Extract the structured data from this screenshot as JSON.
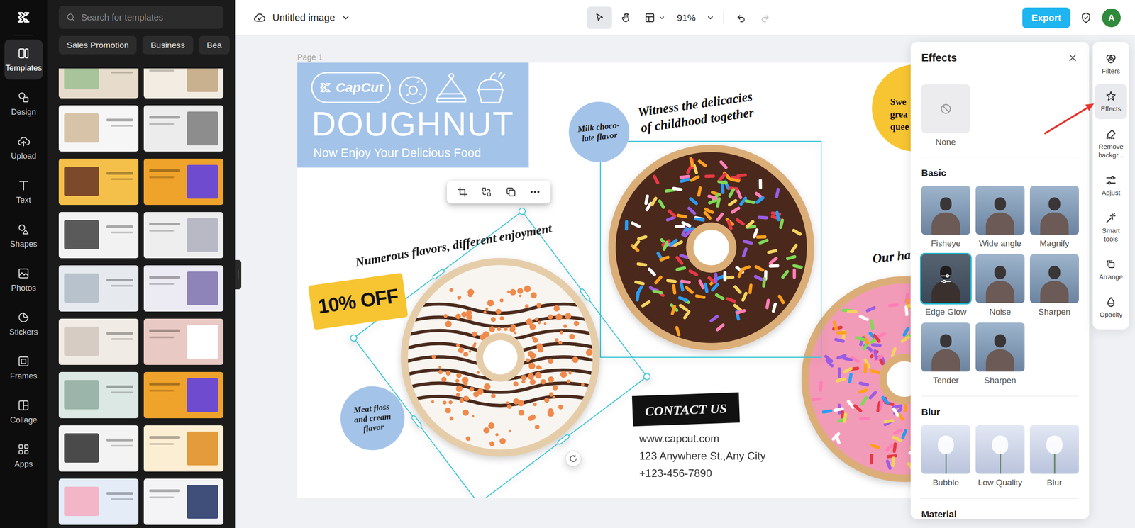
{
  "rail": {
    "items": [
      {
        "label": "Templates",
        "selected": true
      },
      {
        "label": "Design",
        "selected": false
      },
      {
        "label": "Upload",
        "selected": false
      },
      {
        "label": "Text",
        "selected": false
      },
      {
        "label": "Shapes",
        "selected": false
      },
      {
        "label": "Photos",
        "selected": false
      },
      {
        "label": "Stickers",
        "selected": false
      },
      {
        "label": "Frames",
        "selected": false
      },
      {
        "label": "Collage",
        "selected": false
      },
      {
        "label": "Apps",
        "selected": false
      }
    ]
  },
  "templates": {
    "search": {
      "placeholder": "Search for templates"
    },
    "chips": [
      "Sales Promotion",
      "Business",
      "Bea"
    ]
  },
  "toolbar": {
    "title": "Untitled image",
    "zoom": "91%",
    "select_tool": {
      "selected": true
    },
    "hand_tool": {
      "selected": false
    },
    "undo": {
      "disabled": false
    },
    "redo": {
      "disabled": true
    },
    "export": "Export",
    "avatar": "A"
  },
  "canvas": {
    "page_label": "Page 1",
    "banner": {
      "brand": "CapCut",
      "title": "DOUGHNUT",
      "subtitle": "Now Enjoy Your Delicious Food"
    },
    "badge_top": [
      "Milk choco-",
      "late flavor"
    ],
    "badge_bottom": [
      "Meat floss",
      "and cream",
      "flavor"
    ],
    "headline_top": [
      "Witness the delicacies",
      "of childhood together"
    ],
    "headline_left": "Numerous flavors, different enjoyment",
    "headline_right": "Our ha",
    "discount": "10% OFF",
    "yellow_note": [
      "Swe",
      "grea",
      "quee"
    ],
    "contact": {
      "title": "CONTACT US",
      "lines": [
        "www.capcut.com",
        "123 Anywhere St.,Any City",
        "+123-456-7890"
      ]
    },
    "doughnuts": [
      {
        "selection": "selected"
      },
      {
        "selection": "hover"
      },
      {
        "selection": "none"
      }
    ]
  },
  "effects": {
    "title": "Effects",
    "none": {
      "label": "None",
      "selected": false
    },
    "sections": [
      {
        "title": "Basic",
        "items": [
          {
            "label": "Fisheye",
            "selected": false
          },
          {
            "label": "Wide angle",
            "selected": false
          },
          {
            "label": "Magnify",
            "selected": false
          },
          {
            "label": "Edge Glow",
            "selected": true
          },
          {
            "label": "Noise",
            "selected": false
          },
          {
            "label": "Sharpen",
            "selected": false
          },
          {
            "label": "Tender",
            "selected": false
          },
          {
            "label": "Sharpen",
            "selected": false
          }
        ]
      },
      {
        "title": "Blur",
        "items": [
          {
            "label": "Bubble",
            "selected": false
          },
          {
            "label": "Low Quality",
            "selected": false
          },
          {
            "label": "Blur",
            "selected": false
          }
        ]
      },
      {
        "title": "Material",
        "items": []
      }
    ]
  },
  "tools": {
    "items": [
      {
        "label": "Filters",
        "selected": false
      },
      {
        "label": "Effects",
        "selected": true
      },
      {
        "label": "Remove backgr...",
        "selected": false
      },
      {
        "label": "Adjust",
        "selected": false
      },
      {
        "label": "Smart tools",
        "selected": false
      },
      {
        "label": "Arrange",
        "selected": false
      },
      {
        "label": "Opacity",
        "selected": false
      }
    ]
  }
}
